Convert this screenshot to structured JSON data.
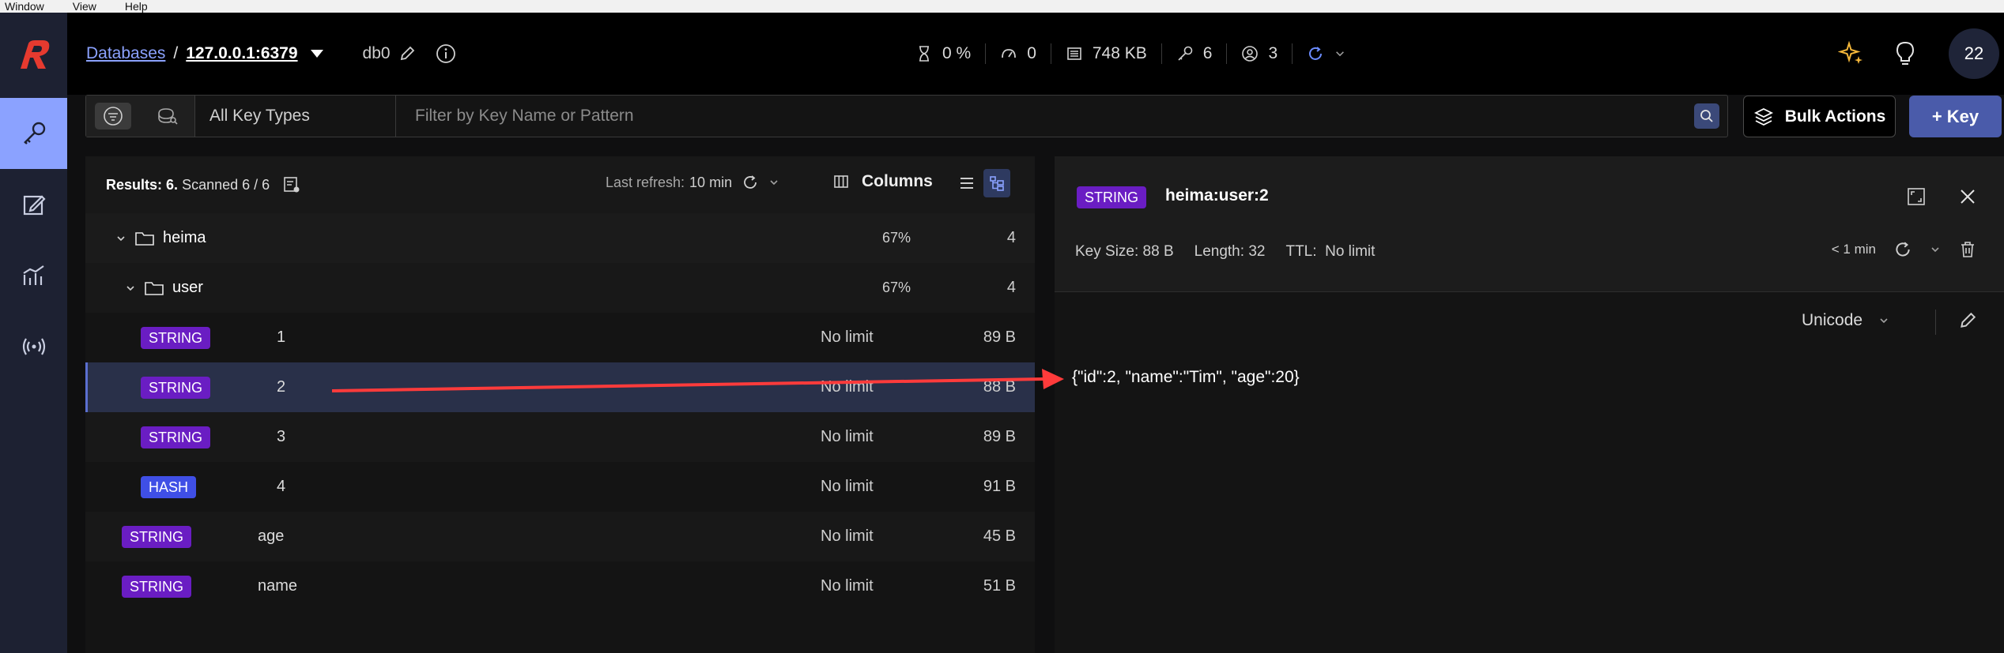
{
  "menu": [
    "Window",
    "View",
    "Help"
  ],
  "sidebar": {
    "items": [
      {
        "name": "browser",
        "icon": "key-icon",
        "active": true
      },
      {
        "name": "workbench",
        "icon": "edit-icon",
        "active": false
      },
      {
        "name": "analytics",
        "icon": "chart-icon",
        "active": false
      },
      {
        "name": "pubsub",
        "icon": "broadcast-icon",
        "active": false
      }
    ]
  },
  "header": {
    "databases_link": "Databases",
    "separator": "/",
    "host": "127.0.0.1:6379",
    "db": "db0",
    "stats": {
      "cpu": "0 %",
      "ops": "0",
      "memory": "748 KB",
      "keys": "6",
      "clients": "3"
    },
    "avatar": "22"
  },
  "filter": {
    "key_type": "All Key Types",
    "placeholder": "Filter by Key Name or Pattern"
  },
  "buttons": {
    "bulk_actions": "Bulk Actions",
    "add_key": "+ Key"
  },
  "list": {
    "results_label": "Results:",
    "results_count": "6.",
    "scanned": "Scanned 6 / 6",
    "last_refresh_label": "Last refresh:",
    "last_refresh_value": "10 min",
    "columns_label": "Columns",
    "folders": [
      {
        "name": "heima",
        "pct": "67%",
        "count": "4"
      },
      {
        "name": "user",
        "pct": "67%",
        "count": "4"
      }
    ],
    "keys": [
      {
        "type": "STRING",
        "name": "1",
        "ttl": "No limit",
        "size": "89 B"
      },
      {
        "type": "STRING",
        "name": "2",
        "ttl": "No limit",
        "size": "88 B"
      },
      {
        "type": "STRING",
        "name": "3",
        "ttl": "No limit",
        "size": "89 B"
      },
      {
        "type": "HASH",
        "name": "4",
        "ttl": "No limit",
        "size": "91 B"
      },
      {
        "type": "STRING",
        "name": "age",
        "ttl": "No limit",
        "size": "45 B"
      },
      {
        "type": "STRING",
        "name": "name",
        "ttl": "No limit",
        "size": "51 B"
      }
    ]
  },
  "detail": {
    "type": "STRING",
    "key_name": "heima:user:2",
    "key_size_label": "Key Size:",
    "key_size": "88 B",
    "length_label": "Length:",
    "length": "32",
    "ttl_label": "TTL:",
    "ttl": "No limit",
    "refreshed": "< 1 min",
    "format": "Unicode",
    "value": "{\"id\":2, \"name\":\"Tim\", \"age\":20}"
  },
  "colors": {
    "accent": "#8ba2ff",
    "string_badge": "#6a1dc3",
    "hash_badge": "#3f4fe6",
    "annotation_arrow": "#ff3b3b"
  }
}
